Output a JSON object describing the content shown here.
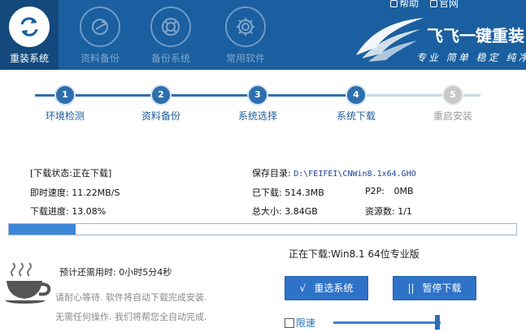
{
  "header": {
    "nav": [
      {
        "label": "重装系统",
        "icon": "refresh-icon",
        "active": true
      },
      {
        "label": "资料备份",
        "icon": "sync-icon",
        "active": false
      },
      {
        "label": "备份系统",
        "icon": "lifebuoy-icon",
        "active": false
      },
      {
        "label": "常用软件",
        "icon": "gear-icon",
        "active": false
      }
    ],
    "links": {
      "help": "帮助",
      "website": "官网"
    },
    "brand": {
      "title": "飞飞一键重装",
      "slogan": "专业 简单 稳定 纯净"
    },
    "colors": {
      "bar": "#1a5f9f",
      "active": "#13497d"
    }
  },
  "steps": [
    {
      "num": "1",
      "label": "环境检测",
      "state": "done"
    },
    {
      "num": "2",
      "label": "资料备份",
      "state": "done"
    },
    {
      "num": "3",
      "label": "系统选择",
      "state": "done"
    },
    {
      "num": "4",
      "label": "系统下载",
      "state": "done"
    },
    {
      "num": "5",
      "label": "重启安装",
      "state": "todo"
    }
  ],
  "download": {
    "status": "[下载状态:正在下载]",
    "speed_label": "即时速度:",
    "speed": "11.22MB/S",
    "progress_label": "下载进度:",
    "progress_text": "13.08%",
    "progress_value": 0.1308,
    "save_label": "保存目录:",
    "save_path": "D:\\FEIFEI\\CNWin8.1x64.GHO",
    "downloaded_label": "已下载:",
    "downloaded": "514.3MB",
    "p2p_label": "P2P:",
    "p2p": "0MB",
    "total_label": "总大小:",
    "total": "3.84GB",
    "sources_label": "资源数:",
    "sources": "1/1",
    "current_label": "正在下载:",
    "current": "Win8.1 64位专业版",
    "eta_label": "预计还需用时:",
    "eta": "0小时5分4秒"
  },
  "notice": {
    "line1": "请耐心等待. 软件将自动下载完成安装.",
    "line2": "无需任何操作. 我们将帮您全自动完成."
  },
  "buttons": {
    "reselect": {
      "glyph": "√",
      "label": "重选系统"
    },
    "pause": {
      "glyph": "||",
      "label": "暂停下载"
    }
  },
  "limit": {
    "label": "限速",
    "checked": false,
    "slider_value": 1.0
  }
}
